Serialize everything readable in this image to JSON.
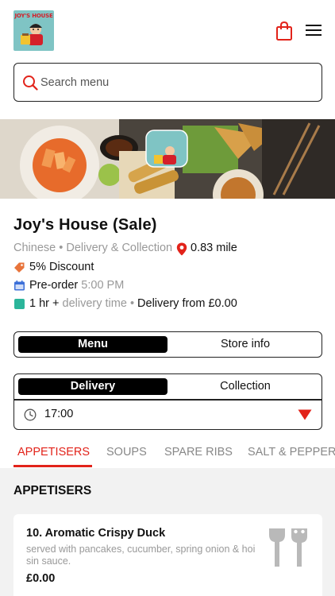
{
  "header": {
    "logo_text": "JOY'S HOUSE",
    "icons": [
      "bag-icon",
      "hamburger-menu-icon"
    ]
  },
  "search": {
    "placeholder": "Search menu"
  },
  "store": {
    "name": "Joy's House (Sale)",
    "cuisine": "Chinese",
    "separator": "•",
    "services": "Delivery & Collection",
    "distance": "0.83 mile",
    "discount": "5% Discount",
    "preorder_label": "Pre-order",
    "preorder_time": "5:00 PM",
    "delivery_duration": "1 hr +",
    "delivery_time_label": "delivery time",
    "delivery_fee": "Delivery from £0.00"
  },
  "view_toggle": {
    "active": "Menu",
    "inactive": "Store info"
  },
  "order_toggle": {
    "active": "Delivery",
    "inactive": "Collection",
    "time": "17:00"
  },
  "category_tabs": [
    "APPETISERS",
    "SOUPS",
    "SPARE RIBS",
    "SALT & PEPPER"
  ],
  "active_category": "APPETISERS",
  "section": {
    "title": "APPETISERS",
    "items": [
      {
        "name": "10. Aromatic Crispy Duck",
        "description": "served with pancakes, cucumber, spring onion & hoi sin sauce.",
        "price": "£0.00"
      }
    ]
  },
  "colors": {
    "accent": "#e2231a",
    "logo_bg": "#7fc4c4",
    "section_bg": "#f2f2f2",
    "discount_icon": "#e8743b",
    "calendar_icon": "#3b6fd8",
    "delivery_icon": "#2bb59a"
  }
}
